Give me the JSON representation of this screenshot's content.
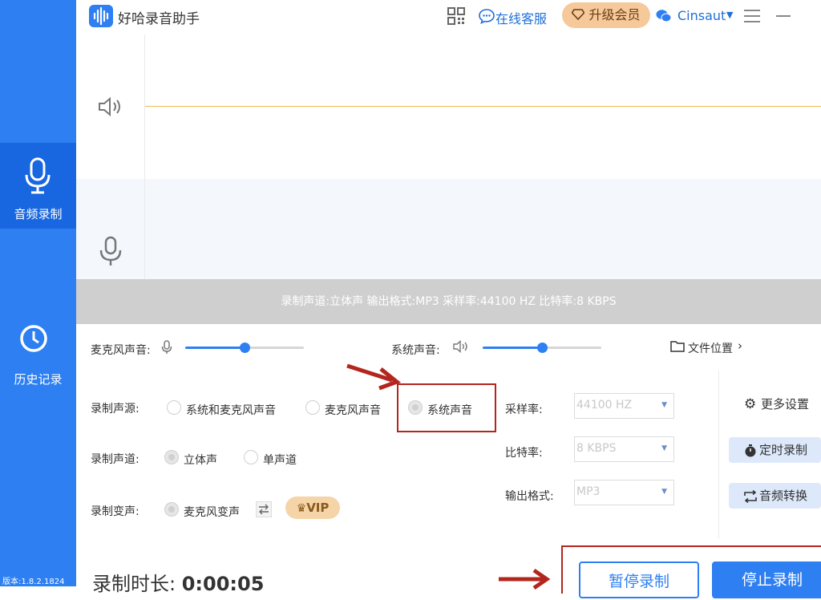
{
  "app": {
    "title": "好哈录音助手"
  },
  "topbar": {
    "service_label": "在线客服",
    "upgrade_label": "升级会员",
    "username": "Cinsaut",
    "icons": [
      "qr-code-icon",
      "chat-bubble-icon",
      "diamond-icon",
      "wechat-icon",
      "menu-icon",
      "minimize-icon"
    ]
  },
  "sidebar": {
    "items": [
      {
        "label": "音频录制",
        "icon": "microphone-icon",
        "active": true
      },
      {
        "label": "历史记录",
        "icon": "clock-icon",
        "active": false
      }
    ],
    "version": "版本:1.8.2.1824"
  },
  "info_bar": {
    "text": "录制声道:立体声 输出格式:MP3 采样率:44100 HZ 比特率:8 KBPS"
  },
  "volume": {
    "mic_label": "麦克风声音:",
    "mic_level": 0.5,
    "system_label": "系统声音:",
    "system_level": 0.5,
    "file_location_label": "文件位置"
  },
  "settings": {
    "source_label": "录制声源:",
    "source_options": [
      "系统和麦克风声音",
      "麦克风声音",
      "系统声音"
    ],
    "source_selected": "系统声音",
    "channel_label": "录制声道:",
    "channel_options": [
      "立体声",
      "单声道"
    ],
    "channel_selected": "立体声",
    "voice_change_label": "录制变声:",
    "voice_change_option": "麦克风变声",
    "vip_label": "VIP",
    "sample_rate_label": "采样率:",
    "sample_rate_value": "44100 HZ",
    "bitrate_label": "比特率:",
    "bitrate_value": "8 KBPS",
    "format_label": "输出格式:",
    "format_value": "MP3",
    "more_settings_label": "更多设置",
    "timer_label": "定时录制",
    "convert_label": "音频转换"
  },
  "recording": {
    "duration_label": "录制时长:",
    "duration_value": "0:00:05",
    "pause_label": "暂停录制",
    "stop_label": "停止录制"
  },
  "colors": {
    "accent": "#2d7ff2",
    "annotation_red": "#b3261e",
    "upgrade_bg": "#f5c99a"
  }
}
